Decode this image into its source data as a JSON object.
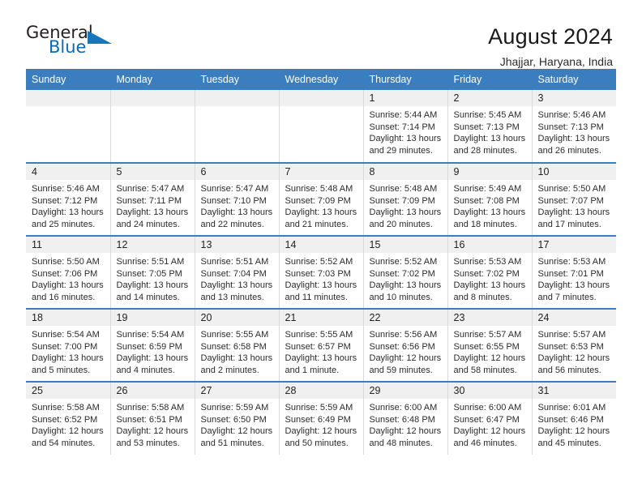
{
  "brand": {
    "name_part1": "General",
    "name_part2": "Blue",
    "accent_color": "#1576bc"
  },
  "header": {
    "title": "August 2024",
    "location": "Jhajjar, Haryana, India"
  },
  "theme": {
    "header_bg": "#3a7ebf",
    "header_text": "#ffffff",
    "daynum_bg": "#f0f0f0",
    "row_divider": "#3a7ebf",
    "cell_divider": "#d9d9d9"
  },
  "weekdays": [
    "Sunday",
    "Monday",
    "Tuesday",
    "Wednesday",
    "Thursday",
    "Friday",
    "Saturday"
  ],
  "labels": {
    "sunrise_prefix": "Sunrise: ",
    "sunset_prefix": "Sunset: ",
    "daylight_prefix": "Daylight: "
  },
  "weeks": [
    [
      {
        "empty": true
      },
      {
        "empty": true
      },
      {
        "empty": true
      },
      {
        "empty": true
      },
      {
        "day": "1",
        "sunrise": "Sunrise: 5:44 AM",
        "sunset": "Sunset: 7:14 PM",
        "daylight": "Daylight: 13 hours and 29 minutes."
      },
      {
        "day": "2",
        "sunrise": "Sunrise: 5:45 AM",
        "sunset": "Sunset: 7:13 PM",
        "daylight": "Daylight: 13 hours and 28 minutes."
      },
      {
        "day": "3",
        "sunrise": "Sunrise: 5:46 AM",
        "sunset": "Sunset: 7:13 PM",
        "daylight": "Daylight: 13 hours and 26 minutes."
      }
    ],
    [
      {
        "day": "4",
        "sunrise": "Sunrise: 5:46 AM",
        "sunset": "Sunset: 7:12 PM",
        "daylight": "Daylight: 13 hours and 25 minutes."
      },
      {
        "day": "5",
        "sunrise": "Sunrise: 5:47 AM",
        "sunset": "Sunset: 7:11 PM",
        "daylight": "Daylight: 13 hours and 24 minutes."
      },
      {
        "day": "6",
        "sunrise": "Sunrise: 5:47 AM",
        "sunset": "Sunset: 7:10 PM",
        "daylight": "Daylight: 13 hours and 22 minutes."
      },
      {
        "day": "7",
        "sunrise": "Sunrise: 5:48 AM",
        "sunset": "Sunset: 7:09 PM",
        "daylight": "Daylight: 13 hours and 21 minutes."
      },
      {
        "day": "8",
        "sunrise": "Sunrise: 5:48 AM",
        "sunset": "Sunset: 7:09 PM",
        "daylight": "Daylight: 13 hours and 20 minutes."
      },
      {
        "day": "9",
        "sunrise": "Sunrise: 5:49 AM",
        "sunset": "Sunset: 7:08 PM",
        "daylight": "Daylight: 13 hours and 18 minutes."
      },
      {
        "day": "10",
        "sunrise": "Sunrise: 5:50 AM",
        "sunset": "Sunset: 7:07 PM",
        "daylight": "Daylight: 13 hours and 17 minutes."
      }
    ],
    [
      {
        "day": "11",
        "sunrise": "Sunrise: 5:50 AM",
        "sunset": "Sunset: 7:06 PM",
        "daylight": "Daylight: 13 hours and 16 minutes."
      },
      {
        "day": "12",
        "sunrise": "Sunrise: 5:51 AM",
        "sunset": "Sunset: 7:05 PM",
        "daylight": "Daylight: 13 hours and 14 minutes."
      },
      {
        "day": "13",
        "sunrise": "Sunrise: 5:51 AM",
        "sunset": "Sunset: 7:04 PM",
        "daylight": "Daylight: 13 hours and 13 minutes."
      },
      {
        "day": "14",
        "sunrise": "Sunrise: 5:52 AM",
        "sunset": "Sunset: 7:03 PM",
        "daylight": "Daylight: 13 hours and 11 minutes."
      },
      {
        "day": "15",
        "sunrise": "Sunrise: 5:52 AM",
        "sunset": "Sunset: 7:02 PM",
        "daylight": "Daylight: 13 hours and 10 minutes."
      },
      {
        "day": "16",
        "sunrise": "Sunrise: 5:53 AM",
        "sunset": "Sunset: 7:02 PM",
        "daylight": "Daylight: 13 hours and 8 minutes."
      },
      {
        "day": "17",
        "sunrise": "Sunrise: 5:53 AM",
        "sunset": "Sunset: 7:01 PM",
        "daylight": "Daylight: 13 hours and 7 minutes."
      }
    ],
    [
      {
        "day": "18",
        "sunrise": "Sunrise: 5:54 AM",
        "sunset": "Sunset: 7:00 PM",
        "daylight": "Daylight: 13 hours and 5 minutes."
      },
      {
        "day": "19",
        "sunrise": "Sunrise: 5:54 AM",
        "sunset": "Sunset: 6:59 PM",
        "daylight": "Daylight: 13 hours and 4 minutes."
      },
      {
        "day": "20",
        "sunrise": "Sunrise: 5:55 AM",
        "sunset": "Sunset: 6:58 PM",
        "daylight": "Daylight: 13 hours and 2 minutes."
      },
      {
        "day": "21",
        "sunrise": "Sunrise: 5:55 AM",
        "sunset": "Sunset: 6:57 PM",
        "daylight": "Daylight: 13 hours and 1 minute."
      },
      {
        "day": "22",
        "sunrise": "Sunrise: 5:56 AM",
        "sunset": "Sunset: 6:56 PM",
        "daylight": "Daylight: 12 hours and 59 minutes."
      },
      {
        "day": "23",
        "sunrise": "Sunrise: 5:57 AM",
        "sunset": "Sunset: 6:55 PM",
        "daylight": "Daylight: 12 hours and 58 minutes."
      },
      {
        "day": "24",
        "sunrise": "Sunrise: 5:57 AM",
        "sunset": "Sunset: 6:53 PM",
        "daylight": "Daylight: 12 hours and 56 minutes."
      }
    ],
    [
      {
        "day": "25",
        "sunrise": "Sunrise: 5:58 AM",
        "sunset": "Sunset: 6:52 PM",
        "daylight": "Daylight: 12 hours and 54 minutes."
      },
      {
        "day": "26",
        "sunrise": "Sunrise: 5:58 AM",
        "sunset": "Sunset: 6:51 PM",
        "daylight": "Daylight: 12 hours and 53 minutes."
      },
      {
        "day": "27",
        "sunrise": "Sunrise: 5:59 AM",
        "sunset": "Sunset: 6:50 PM",
        "daylight": "Daylight: 12 hours and 51 minutes."
      },
      {
        "day": "28",
        "sunrise": "Sunrise: 5:59 AM",
        "sunset": "Sunset: 6:49 PM",
        "daylight": "Daylight: 12 hours and 50 minutes."
      },
      {
        "day": "29",
        "sunrise": "Sunrise: 6:00 AM",
        "sunset": "Sunset: 6:48 PM",
        "daylight": "Daylight: 12 hours and 48 minutes."
      },
      {
        "day": "30",
        "sunrise": "Sunrise: 6:00 AM",
        "sunset": "Sunset: 6:47 PM",
        "daylight": "Daylight: 12 hours and 46 minutes."
      },
      {
        "day": "31",
        "sunrise": "Sunrise: 6:01 AM",
        "sunset": "Sunset: 6:46 PM",
        "daylight": "Daylight: 12 hours and 45 minutes."
      }
    ]
  ]
}
